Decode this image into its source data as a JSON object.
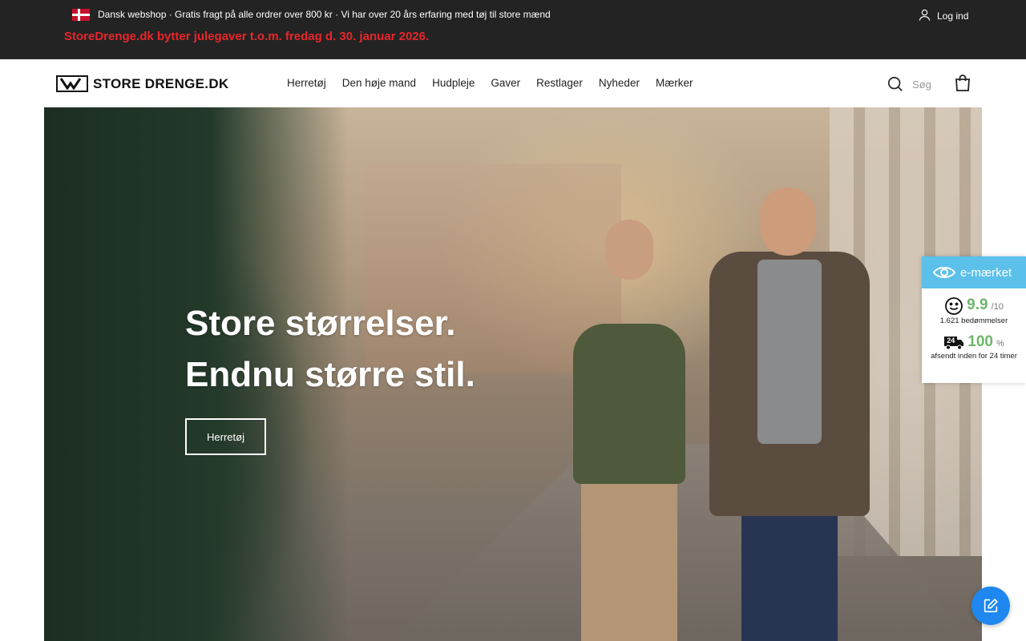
{
  "topbar": {
    "flag_icon": "denmark-flag-icon",
    "info": "Dansk webshop · Gratis fragt på alle ordrer over 800 kr · Vi har over 20 års erfaring med tøj til store mænd",
    "notice": "StoreDrenge.dk bytter julegaver t.o.m. fredag d. 30. januar 2026.",
    "login_label": "Log ind",
    "notice_color": "#e8262b",
    "background_color": "#232323"
  },
  "header": {
    "logo_text": "STORE DRENGE.DK",
    "nav": [
      "Herretøj",
      "Den høje mand",
      "Hudpleje",
      "Gaver",
      "Restlager",
      "Nyheder",
      "Mærker"
    ],
    "search_placeholder": "Søg"
  },
  "hero": {
    "headline_line1": "Store størrelser.",
    "headline_line2": "Endnu større stil.",
    "cta_label": "Herretøj"
  },
  "emark": {
    "title": "e-mærket",
    "rating": "9.9",
    "rating_unit": "/10",
    "reviews": "1.621 bedømmelser",
    "shipped_percent": "100",
    "shipped_unit": "%",
    "shipped_label": "afsendt inden for 24 timer",
    "shipped_badge": "24",
    "accent_color": "#5bc0ea",
    "value_color": "#6db66b"
  },
  "fab": {
    "icon": "edit-icon",
    "color": "#1e88f0"
  }
}
